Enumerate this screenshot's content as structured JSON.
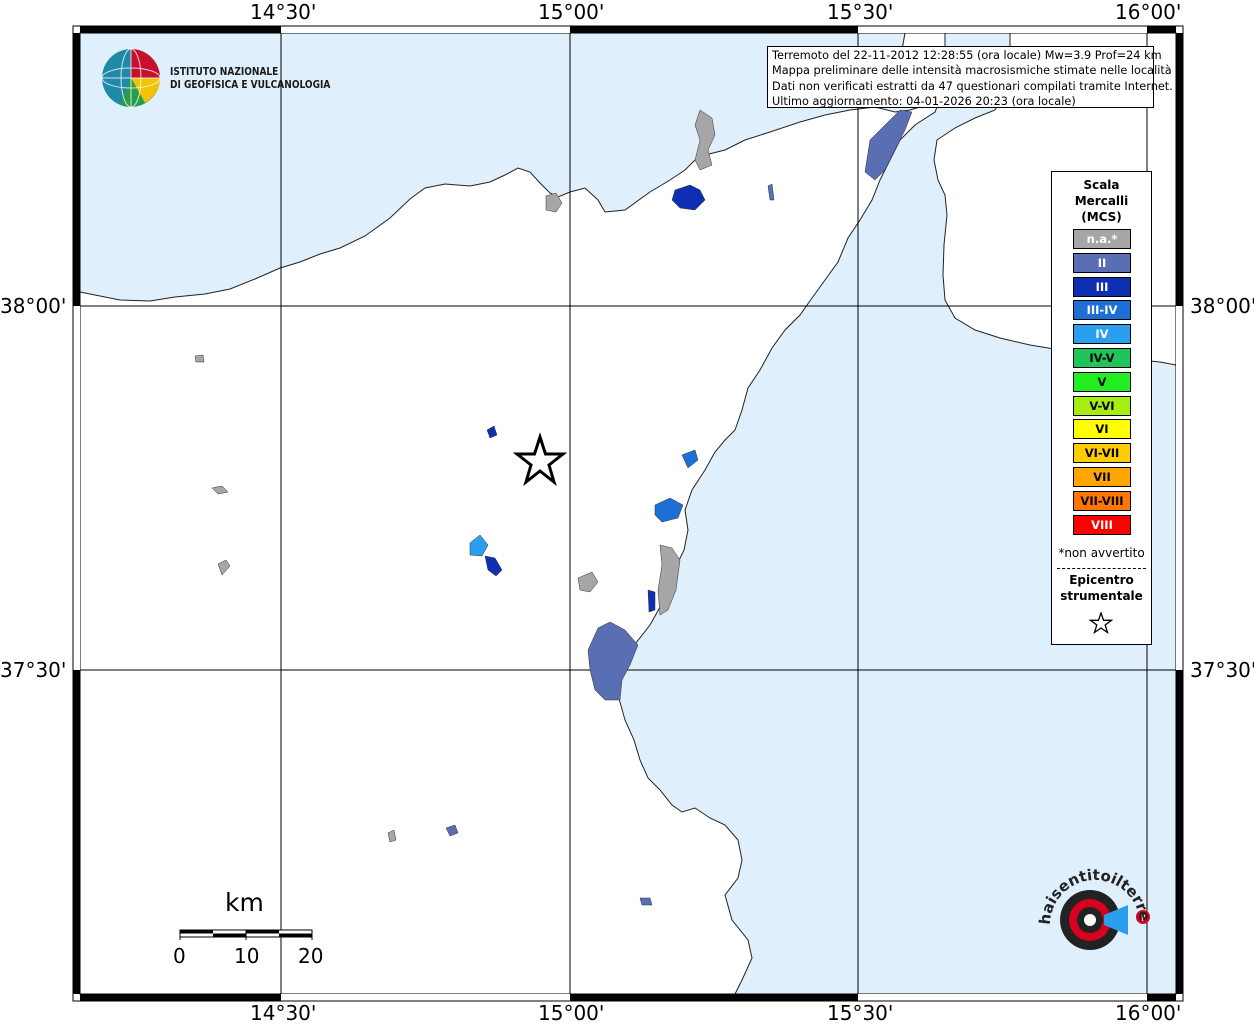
{
  "map": {
    "top_ticks": [
      "14°30'",
      "15°00'",
      "15°30'",
      "16°00'"
    ],
    "bottom_ticks": [
      "14°30'",
      "15°00'",
      "15°30'",
      "16°00'"
    ],
    "left_ticks": [
      "38°00'",
      "37°30'"
    ],
    "right_ticks": [
      "38°00'",
      "37°30'"
    ],
    "colors": {
      "sea": "#dff0fc",
      "land": "#ffffff",
      "not_felt": "#a6a6a6",
      "II": "#5a6eb3",
      "III": "#0f2fb2",
      "III_IV": "#1d6fd6",
      "IV": "#2a9ff0"
    }
  },
  "info": {
    "line1": "Terremoto del 22-11-2012 12:28:55 (ora locale) Mw=3.9 Prof=24 km",
    "line2": "Mappa preliminare delle intensità macrosismiche stimate nelle località",
    "line3": "Dati non verificati estratti da 47 questionari compilati tramite Internet.",
    "line4": "Ultimo aggiornamento: 04-01-2026 20:23 (ora locale)"
  },
  "logo": {
    "line1": "ISTITUTO NAZIONALE",
    "line2": "DI GEOFISICA E VULCANOLOGIA"
  },
  "legend": {
    "title_line1": "Scala",
    "title_line2": "Mercalli",
    "title_line3": "(MCS)",
    "items": [
      {
        "label": "n.a.*",
        "color": "#a6a6a6"
      },
      {
        "label": "II",
        "color": "#5a6eb3"
      },
      {
        "label": "III",
        "color": "#0f2fb2"
      },
      {
        "label": "III-IV",
        "color": "#1d6fd6"
      },
      {
        "label": "IV",
        "color": "#2a9ff0"
      },
      {
        "label": "IV-V",
        "color": "#1fc45a"
      },
      {
        "label": "V",
        "color": "#22ee22"
      },
      {
        "label": "V-VI",
        "color": "#a6ee11"
      },
      {
        "label": "VI",
        "color": "#ffff00"
      },
      {
        "label": "VI-VII",
        "color": "#ffcc00"
      },
      {
        "label": "VII",
        "color": "#ffa500"
      },
      {
        "label": "VII-VIII",
        "color": "#ff7700"
      },
      {
        "label": "VIII",
        "color": "#ff0000"
      }
    ],
    "note": "*non avvertito",
    "epicenter_line1": "Epicentro",
    "epicenter_line2": "strumentale"
  },
  "scale_bar": {
    "unit": "km",
    "labels": [
      "0",
      "10",
      "20"
    ]
  },
  "watermark": {
    "text": "haisentitoilterremoto.it"
  }
}
